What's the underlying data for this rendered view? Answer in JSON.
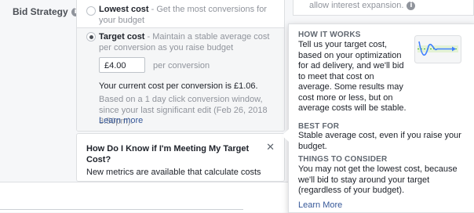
{
  "bid_strategy": {
    "label": "Bid Strategy",
    "info_icon": "info-icon",
    "options": [
      {
        "title": "Lowest cost",
        "description": " - Get the most conversions for your budget",
        "selected": false
      },
      {
        "title": "Target cost",
        "description": " - Maintain a stable average cost per conversion as you raise budget",
        "selected": true
      }
    ],
    "target_cost_value": "£4.00",
    "per_conversion": "per conversion",
    "current_cost": "Your current cost per conversion is £1.06.",
    "based_on": "Based on a 1 day click conversion window, since your last significant edit (Feb 26, 2018 3:50pm).",
    "learn_more": "Learn more"
  },
  "help_box": {
    "title": "How Do I Know if I'm Meeting My Target Cost?",
    "close_icon": "close-icon",
    "body": "New metrics are available that calculate costs"
  },
  "top_right": {
    "text": "allow interest expansion."
  },
  "tooltip": {
    "how_it_works_heading": "HOW IT WORKS",
    "how_it_works_text": "Tell us your target cost, based on your optimization for ad delivery, and we'll bid to meet that cost on average. Some results may cost more or less, but on average costs will be stable.",
    "best_for_heading": "BEST FOR",
    "best_for_text": "Stable average cost, even if you raise your budget.",
    "things_heading": "THINGS TO CONSIDER",
    "things_text": "You may not get the lowest cost, because we'll bid to stay around your target (regardless of your budget).",
    "learn_more": "Learn More"
  },
  "colors": {
    "link": "#365899",
    "muted": "#90949c",
    "accent_blue": "#4080ff",
    "accent_green": "#42b72a"
  }
}
